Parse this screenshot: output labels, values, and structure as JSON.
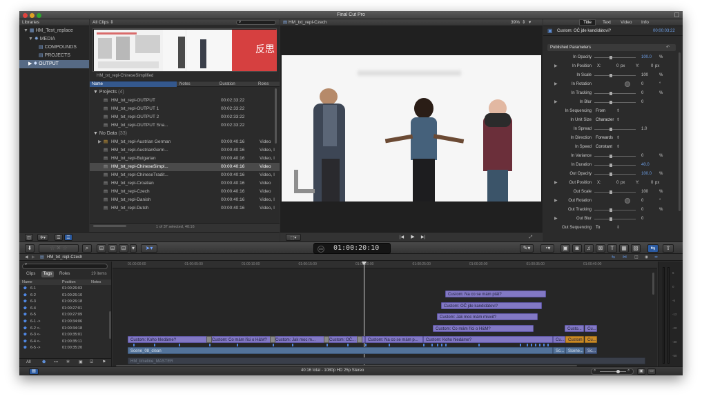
{
  "app": {
    "title": "Final Cut Pro"
  },
  "libraries": {
    "header": "Libraries",
    "items": [
      {
        "label": "HM_Text_replace"
      },
      {
        "label": "MEDIA"
      },
      {
        "label": "COMPOUNDS"
      },
      {
        "label": "PROJECTS"
      },
      {
        "label": "OUTPUT"
      }
    ]
  },
  "browser": {
    "filter": "All Clips",
    "filmstrip_label": "HM_txt_repl-ChineseSimplified",
    "columns": {
      "name": "Name",
      "notes": "Notes",
      "duration": "Duration",
      "roles": "Roles"
    },
    "group_projects": {
      "name": "Projects",
      "count": "(4)"
    },
    "projects": [
      {
        "name": "HM_txt_repl-OUTPUT",
        "duration": "00:02:33:22",
        "roles": ""
      },
      {
        "name": "HM_txt_repl-OUTPUT 1",
        "duration": "00:02:33:22",
        "roles": ""
      },
      {
        "name": "HM_txt_repl-OUTPUT 2",
        "duration": "00:02:33:22",
        "roles": ""
      },
      {
        "name": "HM_txt_repl-OUTPUT Sna...",
        "duration": "00:02:33:22",
        "roles": ""
      }
    ],
    "group_nodata": {
      "name": "No Data",
      "count": "(33)"
    },
    "clips": [
      {
        "name": "HM_txt_repl-Austrian German",
        "duration": "00:00:40:16",
        "roles": "Video"
      },
      {
        "name": "HM_txt_repl-AustrianGerm...",
        "duration": "00:00:40:16",
        "roles": "Video, I"
      },
      {
        "name": "HM_txt_repl-Bulgarian",
        "duration": "00:00:40:16",
        "roles": "Video, I"
      },
      {
        "name": "HM_txt_repl-ChineseSimpl...",
        "duration": "00:00:40:16",
        "roles": "Video"
      },
      {
        "name": "HM_txt_repl-ChineseTradit...",
        "duration": "00:00:40:16",
        "roles": "Video, I"
      },
      {
        "name": "HM_txt_repl-Croatian",
        "duration": "00:00:40:16",
        "roles": "Video"
      },
      {
        "name": "HM_txt_repl-Czech",
        "duration": "00:00:40:16",
        "roles": "Video"
      },
      {
        "name": "HM_txt_repl-Danish",
        "duration": "00:00:40:16",
        "roles": "Video, I"
      },
      {
        "name": "HM_txt_repl-Dutch",
        "duration": "00:00:40:16",
        "roles": "Video, I"
      }
    ],
    "status": "1 of 37 selected, 40:16"
  },
  "viewer": {
    "title": "HM_txt_repl-Czech",
    "zoom": "39%",
    "view_menu": "View"
  },
  "inspector": {
    "tabs": [
      "Title",
      "Text",
      "Video",
      "Info"
    ],
    "clip_name": "Custom: OČ jde kandidátovi?",
    "clip_duration": "00:00:03:22",
    "section": "Published Parameters",
    "params": [
      {
        "label": "In Opacity",
        "value": "100.0",
        "unit": "%"
      },
      {
        "label": "In Position",
        "x": "0",
        "x_unit": "px",
        "y_label": "Y:",
        "y": "0",
        "y_unit": "px"
      },
      {
        "label": "In Scale",
        "value": "100",
        "unit": "%"
      },
      {
        "label": "In Rotation",
        "value": "0",
        "unit": "°"
      },
      {
        "label": "In Tracking",
        "value": "0",
        "unit": "%"
      },
      {
        "label": "In Blur",
        "value": "0",
        "unit": ""
      },
      {
        "label": "In Sequencing",
        "select": "From"
      },
      {
        "label": "In Unit Size",
        "select": "Character"
      },
      {
        "label": "In Spread",
        "value": "1.0",
        "unit": ""
      },
      {
        "label": "In Direction",
        "select": "Forwards"
      },
      {
        "label": "In Speed",
        "select": "Constant"
      },
      {
        "label": "In Variance",
        "value": "0",
        "unit": "%"
      },
      {
        "label": "In Duration",
        "value": "40.0",
        "unit": ""
      },
      {
        "label": "Out Opacity",
        "value": "100.0",
        "unit": "%"
      },
      {
        "label": "Out Position",
        "x": "0",
        "x_unit": "px",
        "y_label": "Y:",
        "y": "0",
        "y_unit": "px"
      },
      {
        "label": "Out Scale",
        "value": "100",
        "unit": "%"
      },
      {
        "label": "Out Rotation",
        "value": "0",
        "unit": "°"
      },
      {
        "label": "Out Tracking",
        "value": "0",
        "unit": "%"
      },
      {
        "label": "Out Blur",
        "value": "0",
        "unit": ""
      },
      {
        "label": "Out Sequencing",
        "select": "To"
      }
    ]
  },
  "toolbar": {
    "timecode": "01:00:20:10",
    "timecode_small": "100"
  },
  "index": {
    "project": "HM_txt_repl-Czech",
    "tabs": [
      "Clips",
      "Tags",
      "Roles"
    ],
    "count": "19 items",
    "columns": {
      "name": "Name",
      "position": "Position",
      "notes": "Notes"
    },
    "rows": [
      {
        "name": "6-1",
        "position": "01:00:26:03"
      },
      {
        "name": "6-2",
        "position": "01:00:26:10"
      },
      {
        "name": "6-3",
        "position": "01:00:26:18"
      },
      {
        "name": "6-4",
        "position": "01:00:27:01"
      },
      {
        "name": "6-5",
        "position": "01:00:27:09"
      },
      {
        "name": "6-1 ->",
        "position": "01:00:34:06"
      },
      {
        "name": "6-2 <-",
        "position": "01:00:34:18"
      },
      {
        "name": "6-3 <-",
        "position": "01:00:35:01"
      },
      {
        "name": "6-4 <-",
        "position": "01:00:35:11"
      },
      {
        "name": "6-5 ->",
        "position": "01:00:35:20"
      }
    ],
    "footer": "All"
  },
  "timeline": {
    "ruler": [
      "01:00:00:00",
      "01:00:05:00",
      "01:00:10:00",
      "01:00:15:00",
      "01:00:20:00",
      "01:00:25:00",
      "01:00:30:00",
      "01:00:35:00",
      "01:00:40:00"
    ],
    "titles_upper": [
      "Custom: Na co se mám ptát?",
      "Custom: OČ jde kandidátovi?",
      "Custom: Jak moc mám mluvit?",
      "Custom: Co mám říci o H&M?",
      "Custo...",
      "Cu..."
    ],
    "titles_lower": [
      "Custom: Koho hledáme?",
      "Custom: Co mám říci o H&M?",
      "Custom: Jak moc m...",
      "Custom: OČ...",
      "Custom: Na co se mám p...",
      "Custom: Koho hledáme?",
      "Cu...",
      "Custom",
      "Cu..."
    ],
    "primary": [
      "Scene_08_clean",
      "Sc...",
      "Scene...",
      "Sc..."
    ],
    "background": "HM_timeline_MASTER"
  },
  "statusbar": {
    "text": "40:16 total - 1080p HD 25p Stereo"
  }
}
